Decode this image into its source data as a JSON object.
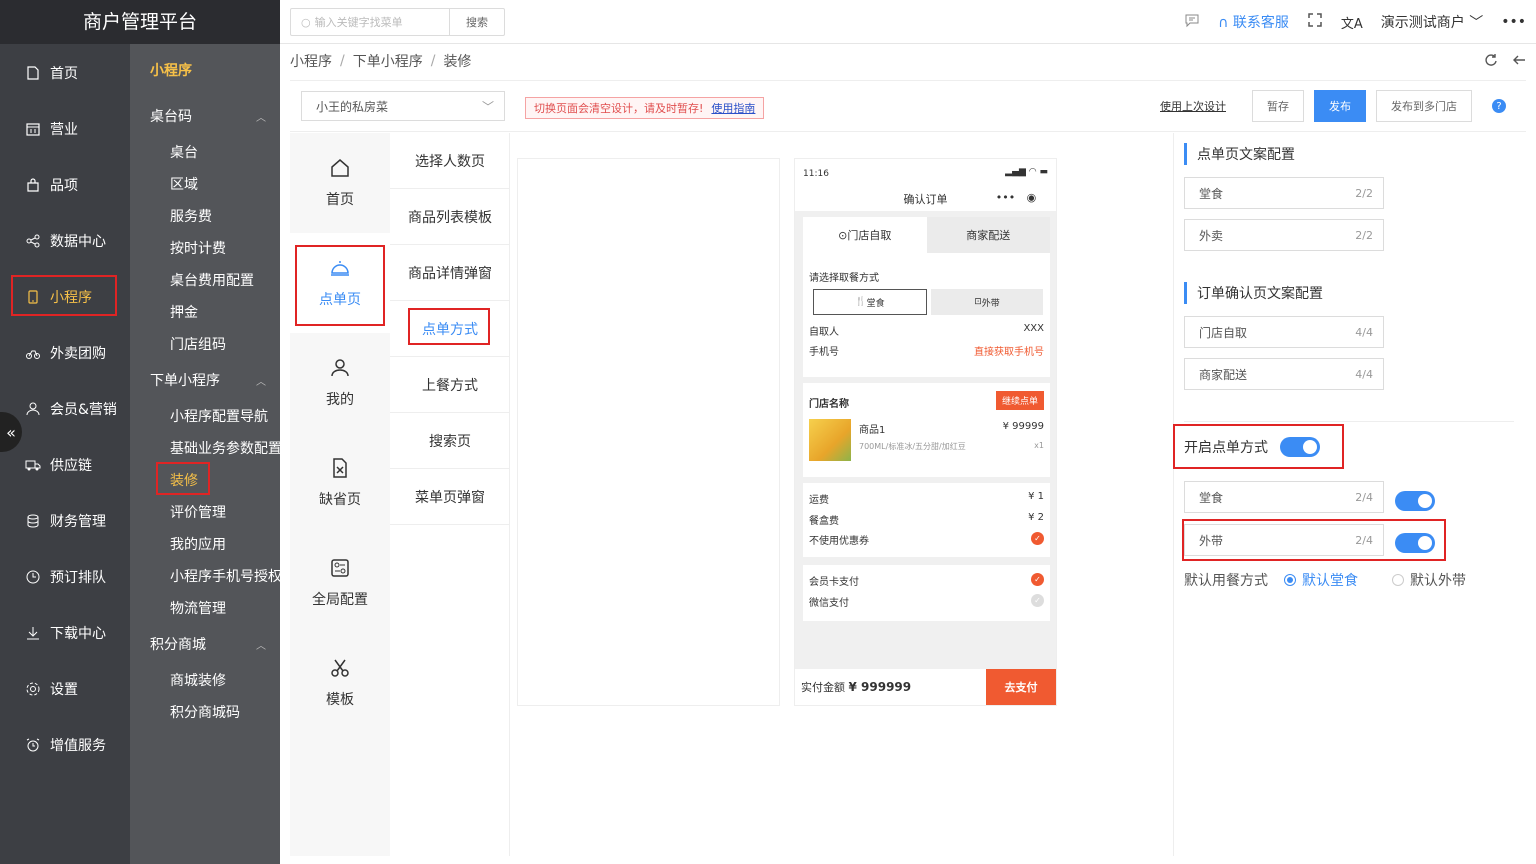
{
  "app": {
    "brand": "商户管理平台"
  },
  "nav": {
    "items": [
      {
        "label": "首页",
        "icon": "home-icon"
      },
      {
        "label": "营业",
        "icon": "calendar-icon"
      },
      {
        "label": "品项",
        "icon": "bag-icon"
      },
      {
        "label": "数据中心",
        "icon": "share-icon"
      },
      {
        "label": "小程序",
        "icon": "phone-icon"
      },
      {
        "label": "外卖团购",
        "icon": "bike-icon"
      },
      {
        "label": "会员&营销",
        "icon": "user-icon"
      },
      {
        "label": "供应链",
        "icon": "truck-icon"
      },
      {
        "label": "财务管理",
        "icon": "database-icon"
      },
      {
        "label": "预订排队",
        "icon": "clock-icon"
      },
      {
        "label": "下载中心",
        "icon": "download-icon"
      },
      {
        "label": "设置",
        "icon": "gear-icon"
      },
      {
        "label": "增值服务",
        "icon": "alarm-icon"
      }
    ],
    "collapse": "«"
  },
  "subnav": {
    "title": "小程序",
    "group1": "桌台码",
    "group1_items": [
      "桌台",
      "区域",
      "服务费",
      "按时计费",
      "桌台费用配置",
      "押金",
      "门店组码"
    ],
    "group2": "下单小程序",
    "group2_items": [
      "小程序配置导航",
      "基础业务参数配置",
      "装修",
      "评价管理",
      "我的应用",
      "小程序手机号授权",
      "物流管理"
    ],
    "group3": "积分商城",
    "group3_items": [
      "商城装修",
      "积分商城码"
    ]
  },
  "topbar": {
    "search_placeholder": "输入关键字找菜单",
    "search_btn": "搜索",
    "service": "联系客服",
    "merchant": "演示测试商户",
    "more": "•••"
  },
  "breadcrumb": [
    "小程序",
    "下单小程序",
    "装修"
  ],
  "actions": {
    "store": "小王的私房菜",
    "warning": "切换页面会清空设计，请及时暂存!",
    "guide": "使用指南",
    "use_last": "使用上次设计",
    "save": "暂存",
    "publish": "发布",
    "publish_multi": "发布到多门店",
    "help": "?"
  },
  "editor": {
    "pages": [
      {
        "label": "首页",
        "icon": "home-icon"
      },
      {
        "label": "点单页",
        "icon": "cloche-icon"
      },
      {
        "label": "我的",
        "icon": "user-icon"
      },
      {
        "label": "缺省页",
        "icon": "file-x-icon"
      },
      {
        "label": "全局配置",
        "icon": "settings-panel-icon"
      },
      {
        "label": "模板",
        "icon": "scissors-icon"
      }
    ],
    "subpages": [
      "选择人数页",
      "商品列表模板",
      "商品详情弹窗",
      "点单方式",
      "上餐方式",
      "搜索页",
      "菜单页弹窗"
    ]
  },
  "phone": {
    "time": "11:16",
    "signal": "▂▄▆ ◠ ▬",
    "title": "确认订单",
    "capsule": [
      "•••",
      "◉"
    ],
    "tab_pickup": "门店自取",
    "tab_delivery": "商家配送",
    "dine_prompt": "请选择取餐方式",
    "dine_in": "堂食",
    "takeaway": "外带",
    "pickup_person_label": "自取人",
    "pickup_person_value": "XXX",
    "phone_label": "手机号",
    "phone_value": "直接获取手机号",
    "store_name": "门店名称",
    "continue": "继续点单",
    "product_name": "商品1",
    "product_price": "¥ 99999",
    "product_desc": "700ML/标准冰/五分甜/加红豆",
    "product_qty": "x1",
    "freight_label": "运费",
    "freight_value": "¥ 1",
    "box_label": "餐盒费",
    "box_value": "¥ 2",
    "coupon_label": "不使用优惠券",
    "member_pay": "会员卡支付",
    "wechat_pay": "微信支付",
    "total_label": "实付金额",
    "total_value": "¥ 999999",
    "pay_btn": "去支付"
  },
  "right": {
    "sec1": "点单页文案配置",
    "sec1_fields": [
      {
        "label": "堂食",
        "count": "2/2"
      },
      {
        "label": "外卖",
        "count": "2/2"
      }
    ],
    "sec2": "订单确认页文案配置",
    "sec2_fields": [
      {
        "label": "门店自取",
        "count": "4/4"
      },
      {
        "label": "商家配送",
        "count": "4/4"
      }
    ],
    "enable_label": "开启点单方式",
    "mode_fields": [
      {
        "label": "堂食",
        "count": "2/4"
      },
      {
        "label": "外带",
        "count": "2/4"
      }
    ],
    "default_label": "默认用餐方式",
    "default_dine": "默认堂食",
    "default_take": "默认外带"
  },
  "colors": {
    "accent": "#3b8cf4",
    "highlight": "#e02424",
    "active_nav": "#f7c148",
    "pay": "#f05a31"
  }
}
